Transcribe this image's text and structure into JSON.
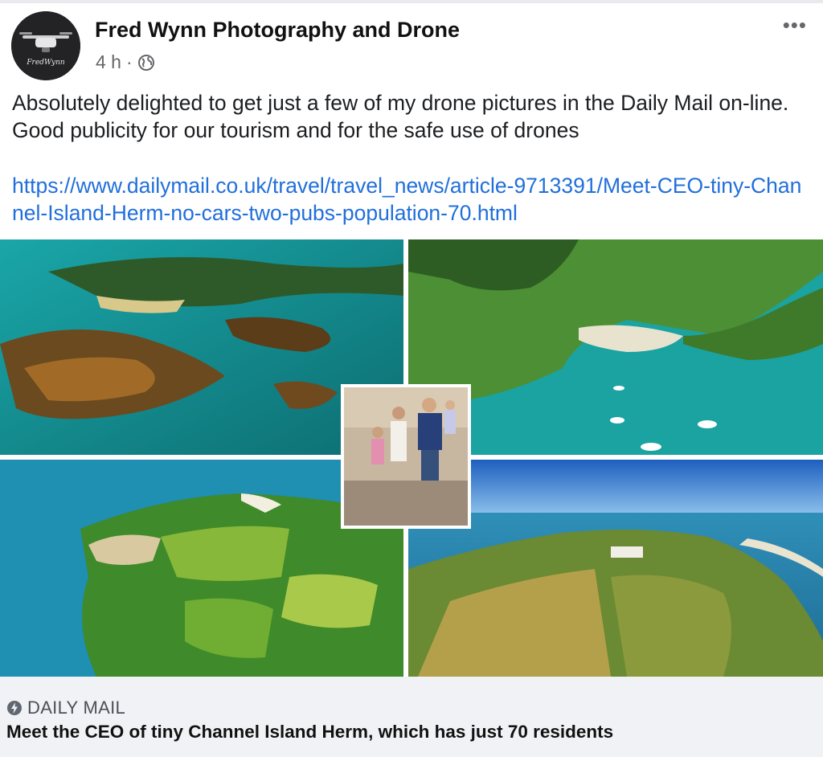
{
  "post": {
    "author": "Fred Wynn Photography and Drone",
    "time": "4 h",
    "separator": "·",
    "audience_icon": "globe-icon",
    "more_label": "•••",
    "text": "Absolutely delighted to get just a few of my drone pictures in the Daily Mail on-line. Good publicity for our tourism and for the safe use of drones",
    "link": "https://www.dailymail.co.uk/travel/travel_news/article-9713391/Meet-CEO-tiny-Channel-Island-Herm-no-cars-two-pubs-population-70.html"
  },
  "avatar": {
    "logo_text": "FredWynn"
  },
  "link_preview": {
    "source_icon": "lightning-icon",
    "source": "DAILY MAIL",
    "headline": "Meet the CEO of tiny Channel Island Herm, which has just 70 residents"
  },
  "colors": {
    "link": "#216fdb",
    "preview_bg": "#f0f2f5",
    "muted": "#65676b"
  }
}
